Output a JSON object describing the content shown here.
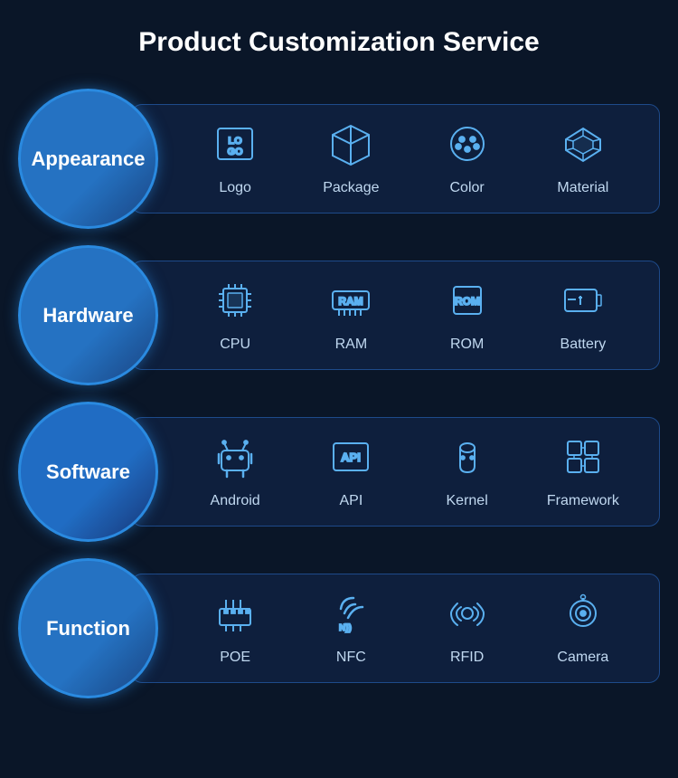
{
  "title": "Product Customization Service",
  "sections": [
    {
      "id": "appearance",
      "label": "Appearance",
      "items": [
        {
          "id": "logo",
          "label": "Logo",
          "icon": "logo"
        },
        {
          "id": "package",
          "label": "Package",
          "icon": "package"
        },
        {
          "id": "color",
          "label": "Color",
          "icon": "color"
        },
        {
          "id": "material",
          "label": "Material",
          "icon": "material"
        }
      ]
    },
    {
      "id": "hardware",
      "label": "Hardware",
      "items": [
        {
          "id": "cpu",
          "label": "CPU",
          "icon": "cpu"
        },
        {
          "id": "ram",
          "label": "RAM",
          "icon": "ram"
        },
        {
          "id": "rom",
          "label": "ROM",
          "icon": "rom"
        },
        {
          "id": "battery",
          "label": "Battery",
          "icon": "battery"
        }
      ]
    },
    {
      "id": "software",
      "label": "Software",
      "items": [
        {
          "id": "android",
          "label": "Android",
          "icon": "android"
        },
        {
          "id": "api",
          "label": "API",
          "icon": "api"
        },
        {
          "id": "kernel",
          "label": "Kernel",
          "icon": "kernel"
        },
        {
          "id": "framework",
          "label": "Framework",
          "icon": "framework"
        }
      ]
    },
    {
      "id": "function",
      "label": "Function",
      "items": [
        {
          "id": "poe",
          "label": "POE",
          "icon": "poe"
        },
        {
          "id": "nfc",
          "label": "NFC",
          "icon": "nfc"
        },
        {
          "id": "rfid",
          "label": "RFID",
          "icon": "rfid"
        },
        {
          "id": "camera",
          "label": "Camera",
          "icon": "camera"
        }
      ]
    }
  ]
}
